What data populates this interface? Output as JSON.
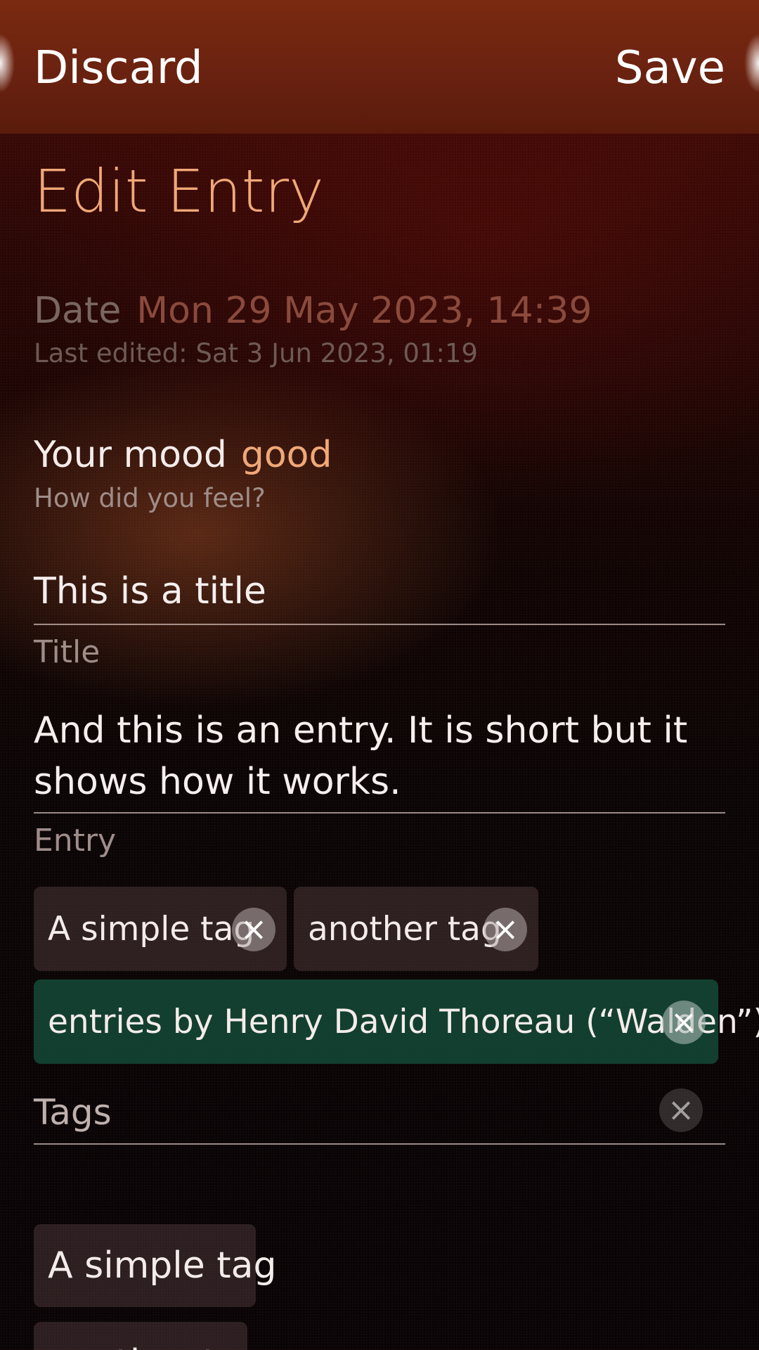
{
  "header": {
    "discard_label": "Discard",
    "save_label": "Save"
  },
  "page": {
    "title": "Edit Entry"
  },
  "date": {
    "label": "Date",
    "value": "Mon 29 May 2023, 14:39",
    "last_edited": "Last edited: Sat 3 Jun 2023, 01:19"
  },
  "mood": {
    "label": "Your mood",
    "value": "good",
    "hint": "How did you feel?"
  },
  "title_field": {
    "value": "This is a title",
    "label": "Title"
  },
  "entry_field": {
    "value": "And this is an entry. It is short but it shows how it works.",
    "label": "Entry"
  },
  "tags": {
    "items": [
      {
        "label": "A simple tag"
      },
      {
        "label": "another tag"
      },
      {
        "label": "entries by Henry David Thoreau (“Walden”)"
      }
    ],
    "input_placeholder": "Tags",
    "remove_glyph": "×"
  },
  "suggestions": {
    "items": [
      {
        "label": "A simple tag"
      },
      {
        "label": "another tag"
      }
    ]
  },
  "colors": {
    "accent": "#f0a878",
    "header_bg": "#6a2210",
    "highlight_tag_bg": "#14503c"
  },
  "icons": {
    "tag_remove": "close-icon",
    "tags_clear": "clear-icon"
  }
}
